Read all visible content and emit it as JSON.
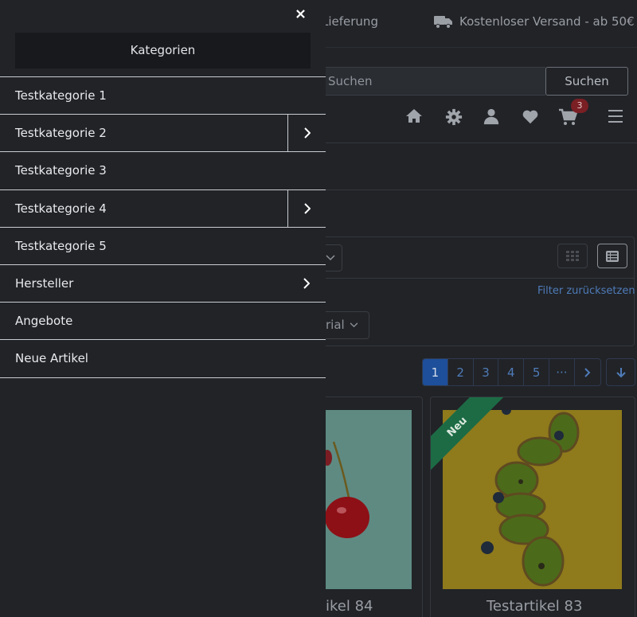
{
  "drawer": {
    "close_label": "×",
    "title": "Kategorien",
    "items": [
      {
        "label": "Testkategorie 1",
        "has_children": false
      },
      {
        "label": "Testkategorie 2",
        "has_children": true
      },
      {
        "label": "Testkategorie 3",
        "has_children": false
      },
      {
        "label": "Testkategorie 4",
        "has_children": true
      },
      {
        "label": "Testkategorie 5",
        "has_children": false
      },
      {
        "label": "Hersteller",
        "has_children": true
      },
      {
        "label": "Angebote",
        "has_children": false
      },
      {
        "label": "Neue Artikel",
        "has_children": false
      }
    ]
  },
  "topbar": {
    "usp_delivery": "e Lieferung",
    "usp_shipping": "Kostenloser Versand - ab 50€"
  },
  "search": {
    "placeholder": "Suchen",
    "button": "Suchen"
  },
  "header_icons": [
    "home-icon",
    "gear-icon",
    "user-icon",
    "heart-icon",
    "cart-icon",
    "menu-icon"
  ],
  "cart": {
    "count": "3"
  },
  "filters": {
    "reset_label": "Filter zurücksetzen",
    "material_label": "rial"
  },
  "pagination": {
    "pages": [
      "1",
      "2",
      "3",
      "4",
      "5",
      "···"
    ],
    "active": "1"
  },
  "products": [
    {
      "title": "ikel 84",
      "badge": ""
    },
    {
      "title": "Testartikel 83",
      "badge": "Neu"
    }
  ],
  "colors": {
    "accent": "#1d4f9a",
    "link": "#4f7bb8",
    "ribbon": "#1c6b45",
    "badge": "#7a1f24"
  }
}
